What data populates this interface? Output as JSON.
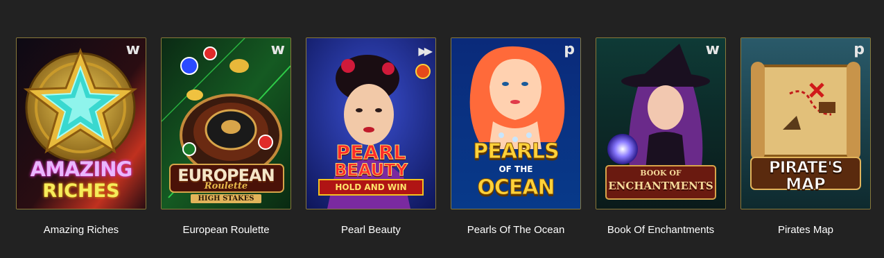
{
  "games": [
    {
      "title": "Amazing Riches",
      "provider_badge": "w",
      "provider_icon": "provider-w-icon",
      "art": {
        "line1": "AMAZING",
        "line2": "RICHES",
        "colors": [
          "#120c1a",
          "#c0311f",
          "#3bd6d0",
          "#e4b73c"
        ]
      }
    },
    {
      "title": "European Roulette",
      "provider_badge": "w",
      "provider_icon": "provider-w-icon",
      "art": {
        "line1": "EUROPEAN",
        "line2": "Roulette",
        "line3": "HIGH STAKES",
        "colors": [
          "#0c3518",
          "#2fd24a",
          "#7a2a1a",
          "#e0b04a"
        ]
      }
    },
    {
      "title": "Pearl Beauty",
      "provider_badge": "▶▶",
      "provider_icon": "provider-play-icon",
      "art": {
        "line1": "PEARL",
        "line2": "BEAUTY",
        "line3": "HOLD AND WIN",
        "colors": [
          "#101a6a",
          "#2d3fb0",
          "#d41b1b",
          "#f5c21d"
        ]
      }
    },
    {
      "title": "Pearls Of The Ocean",
      "provider_badge": "p",
      "provider_icon": "provider-p-icon",
      "art": {
        "line1": "PEARLS",
        "line2": "OF THE",
        "line3": "OCEAN",
        "colors": [
          "#0a3a8a",
          "#2c6fd0",
          "#ff6a3a",
          "#f2c531"
        ]
      }
    },
    {
      "title": "Book Of Enchantments",
      "provider_badge": "w",
      "provider_icon": "provider-w-icon",
      "art": {
        "line1": "BOOK OF",
        "line2": "ENCHANTMENTS",
        "colors": [
          "#0b2a2e",
          "#3a6a4a",
          "#6a2a6a",
          "#e2b04a"
        ]
      }
    },
    {
      "title": "Pirates Map",
      "provider_badge": "p",
      "provider_icon": "provider-p-icon",
      "art": {
        "line1": "PIRATE'S",
        "line2": "MAP",
        "colors": [
          "#1c4a5a",
          "#4a8a9a",
          "#d8a95a",
          "#f1d07a"
        ]
      }
    }
  ]
}
